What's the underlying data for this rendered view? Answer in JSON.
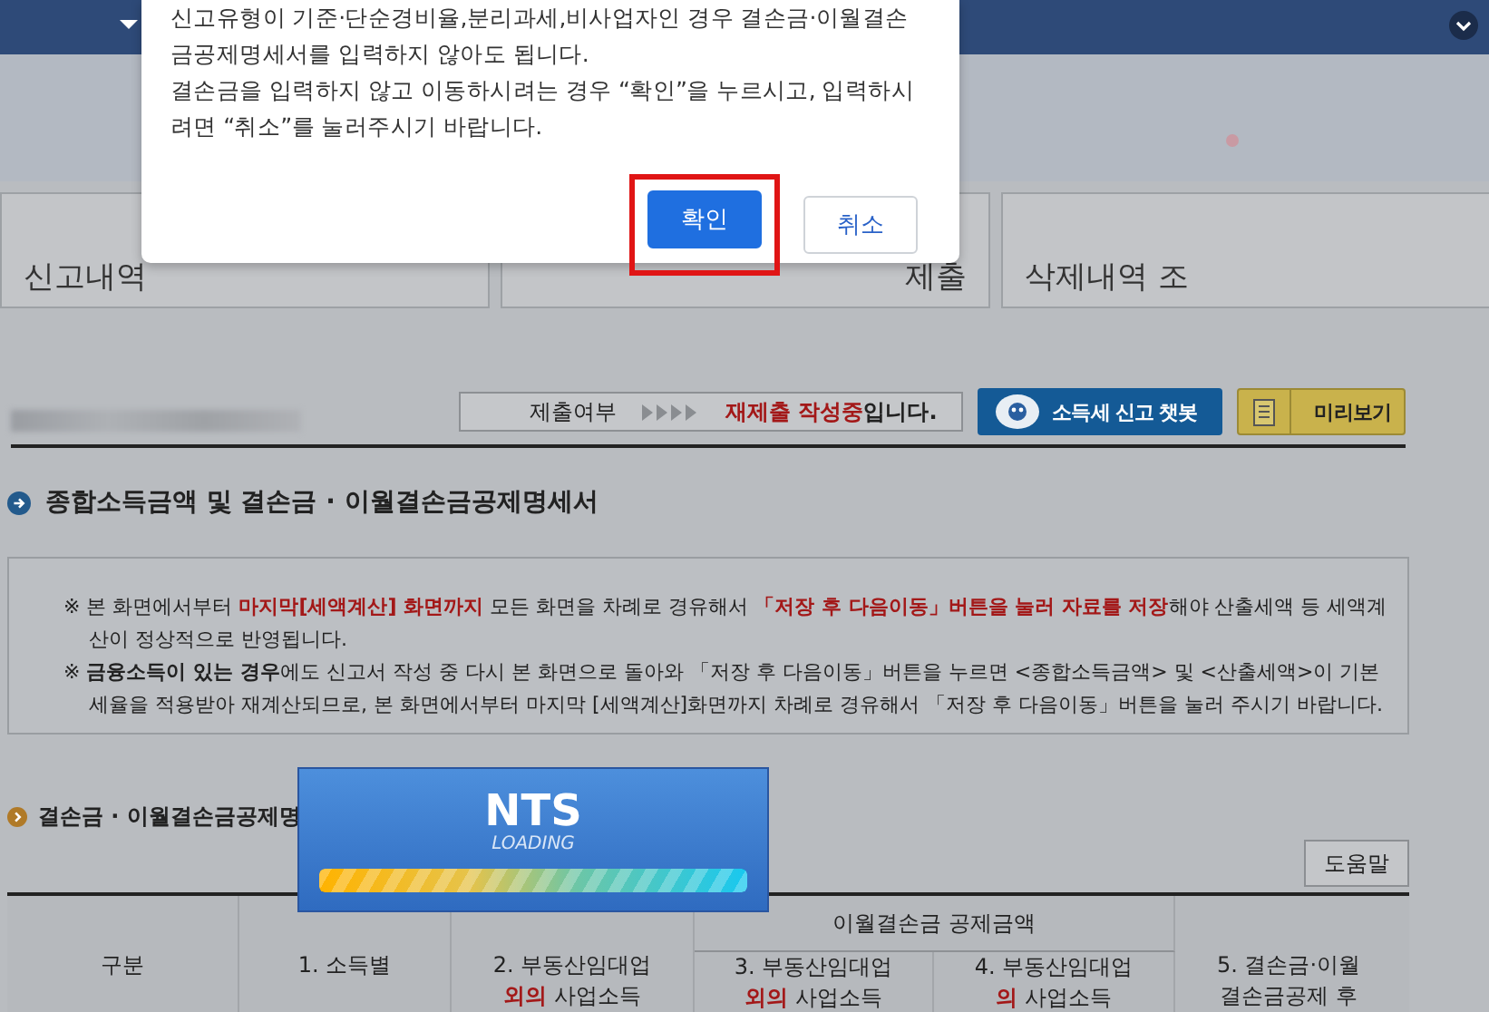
{
  "dialog": {
    "lines": [
      "신고유형이 기준·단순경비율,분리과세,비사업자인 경우 결손금·이월결손금공제명세서를 입력하지 않아도 됩니다.",
      "결손금을 입력하지 않고 이동하시려는 경우 “확인”을 누르시고, 입력하시려면 “취소”를 눌러주시기 바랍니다."
    ],
    "buttons": [
      {
        "label": "확인",
        "kind": "primary",
        "highlighted": true
      },
      {
        "label": "취소",
        "kind": "secondary",
        "highlighted": false
      }
    ]
  },
  "tabs": [
    {
      "label": "신고내역"
    },
    {
      "label": "제출"
    },
    {
      "label": "삭제내역 조"
    }
  ],
  "status": {
    "label": "제출여부",
    "segments": [
      {
        "text": "재제출 작성중",
        "kind": "alert"
      },
      {
        "text": "입니다.",
        "kind": "strong"
      }
    ]
  },
  "actions": [
    {
      "label": "소득세 신고 챗봇",
      "kind": "chatbot"
    },
    {
      "label": "미리보기",
      "kind": "preview"
    }
  ],
  "page_title": "종합소득금액 및 결손금 · 이월결손금공제명세서",
  "notice": [
    {
      "segments": [
        {
          "text": "※ 본 화면에서부터 ",
          "kind": "plain"
        },
        {
          "text": "마지막[세액계산] 화면까지",
          "kind": "alert"
        },
        {
          "text": " 모든 화면을 차례로 경유해서 ",
          "kind": "plain"
        },
        {
          "text": "「저장 후 다음이동」버튼을 눌러 자료를 저장",
          "kind": "alert"
        },
        {
          "text": "해야 산출세액 등 세액계산이 정상적으로 반영됩니다.",
          "kind": "plain"
        }
      ]
    },
    {
      "segments": [
        {
          "text": "※ ",
          "kind": "plain"
        },
        {
          "text": "금융소득이 있는 경우",
          "kind": "strong"
        },
        {
          "text": "에도 신고서 작성 중 다시 본 화면으로 돌아와 「저장 후 다음이동」버튼을 누르면 <종합소득금액> 및 <산출세액>이 기본세율을 적용받아 재계산되므로, 본 화면에서부터 마지막 [세액계산]화면까지 차례로 경유해서 「저장 후 다음이동」버튼을 눌러 주시기 바랍니다.",
          "kind": "plain"
        }
      ]
    }
  ],
  "section_title": "결손금 · 이월결손금공제명",
  "help_button": "도움말",
  "loading": {
    "title": "NTS",
    "subtitle": "LOADING",
    "level": 1
  },
  "table": {
    "group_header": "이월결손금 공제금액",
    "columns": [
      {
        "lines": [
          [
            {
              "text": "구분",
              "kind": "plain"
            }
          ]
        ],
        "grouped": false
      },
      {
        "lines": [
          [
            {
              "text": "1. 소득별",
              "kind": "plain"
            }
          ]
        ],
        "grouped": false
      },
      {
        "lines": [
          [
            {
              "text": "2. 부동산임대업",
              "kind": "plain"
            }
          ],
          [
            {
              "text": "외의",
              "kind": "alert"
            },
            {
              "text": " 사업소득",
              "kind": "plain"
            }
          ]
        ],
        "grouped": false
      },
      {
        "lines": [
          [
            {
              "text": "3. 부동산임대업",
              "kind": "plain"
            }
          ],
          [
            {
              "text": "외의",
              "kind": "alert"
            },
            {
              "text": " 사업소득",
              "kind": "plain"
            }
          ]
        ],
        "grouped": true
      },
      {
        "lines": [
          [
            {
              "text": "4. 부동산임대업",
              "kind": "plain"
            }
          ],
          [
            {
              "text": "의",
              "kind": "alert"
            },
            {
              "text": " 사업소득",
              "kind": "plain"
            }
          ]
        ],
        "grouped": true
      },
      {
        "lines": [
          [
            {
              "text": "5. 결손금·이월",
              "kind": "plain"
            }
          ],
          [
            {
              "text": "결손금공제 후",
              "kind": "plain"
            }
          ]
        ],
        "grouped": false
      }
    ]
  }
}
